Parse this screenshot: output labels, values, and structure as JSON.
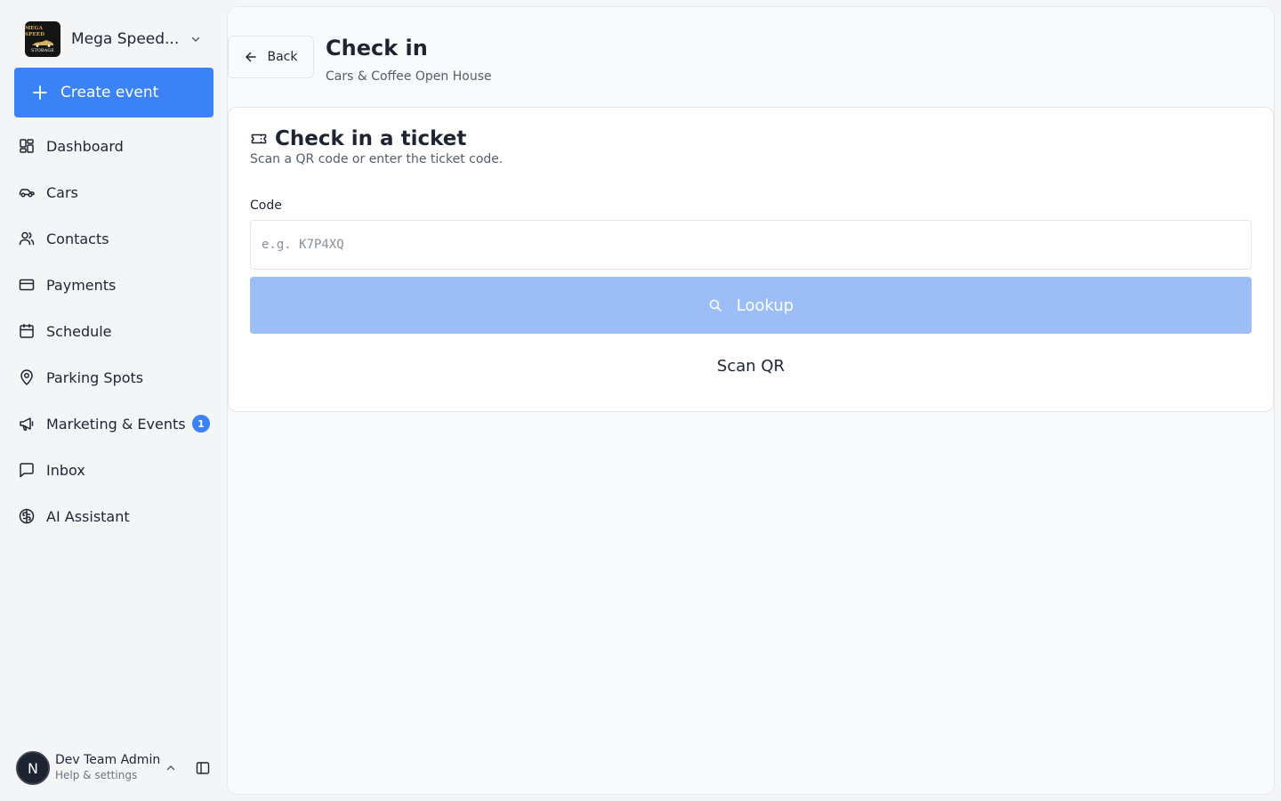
{
  "org": {
    "name": "Mega Speed...",
    "logo_text_top": "MEGA SPEED",
    "logo_text_bottom": "STORAGE",
    "logo_icon": "car-logo-icon"
  },
  "sidebar": {
    "create_label": "Create event",
    "items": [
      {
        "label": "Dashboard",
        "icon": "dashboard-icon"
      },
      {
        "label": "Cars",
        "icon": "car-icon"
      },
      {
        "label": "Contacts",
        "icon": "users-icon"
      },
      {
        "label": "Payments",
        "icon": "credit-card-icon"
      },
      {
        "label": "Schedule",
        "icon": "calendar-icon"
      },
      {
        "label": "Parking Spots",
        "icon": "map-pin-icon"
      },
      {
        "label": "Marketing & Events",
        "icon": "megaphone-icon",
        "badge": "1"
      },
      {
        "label": "Inbox",
        "icon": "message-square-icon"
      },
      {
        "label": "AI Assistant",
        "icon": "brain-icon"
      }
    ]
  },
  "user": {
    "initial": "N",
    "name": "Dev Team Admin",
    "subtitle": "Help & settings"
  },
  "header": {
    "back_label": "Back",
    "title": "Check in",
    "subtitle": "Cars & Coffee Open House"
  },
  "card": {
    "title": "Check in a ticket",
    "description": "Scan a QR code or enter the ticket code.",
    "code_label": "Code",
    "code_placeholder": "e.g. K7P4XQ",
    "code_value": "",
    "lookup_label": "Lookup",
    "scan_label": "Scan QR"
  },
  "colors": {
    "accent": "#3b82f6",
    "accent_disabled": "#9dbdf6",
    "text": "#1e2432",
    "muted": "#555d6b"
  }
}
